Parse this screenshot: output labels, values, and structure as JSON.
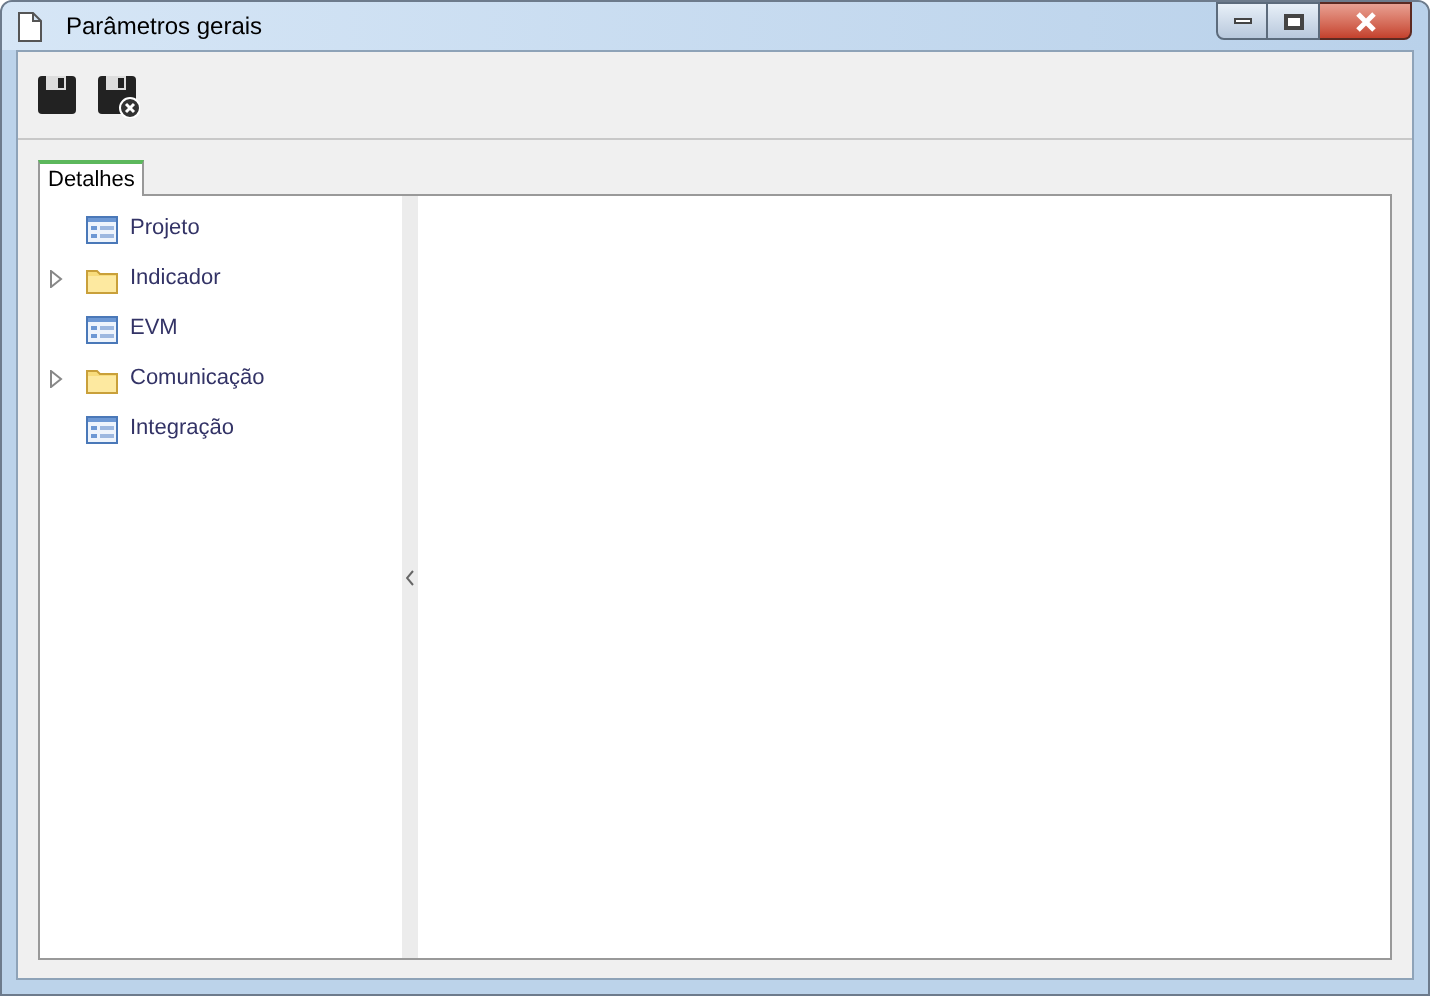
{
  "window": {
    "title": "Parâmetros gerais"
  },
  "tabs": [
    {
      "label": "Detalhes",
      "selected": true
    }
  ],
  "tree": [
    {
      "label": "Projeto",
      "kind": "page"
    },
    {
      "label": "Indicador",
      "kind": "folder",
      "expanded": false
    },
    {
      "label": "EVM",
      "kind": "page"
    },
    {
      "label": "Comunicação",
      "kind": "folder",
      "expanded": false
    },
    {
      "label": "Integração",
      "kind": "page"
    }
  ]
}
